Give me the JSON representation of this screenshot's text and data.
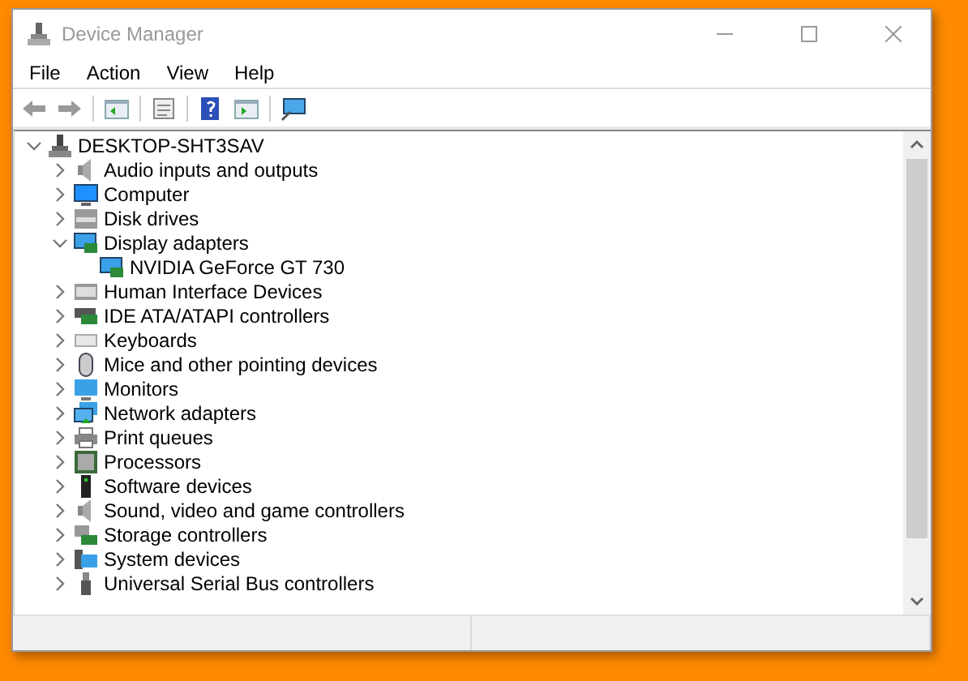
{
  "window": {
    "title": "Device Manager"
  },
  "menu": [
    "File",
    "Action",
    "View",
    "Help"
  ],
  "tree": {
    "label": "DESKTOP-SHT3SAV",
    "expanded": true,
    "children": [
      {
        "label": "Audio inputs and outputs",
        "expanded": false
      },
      {
        "label": "Computer",
        "expanded": false
      },
      {
        "label": "Disk drives",
        "expanded": false
      },
      {
        "label": "Display adapters",
        "expanded": true,
        "children": [
          {
            "label": "NVIDIA GeForce GT 730"
          }
        ]
      },
      {
        "label": "Human Interface Devices",
        "expanded": false
      },
      {
        "label": "IDE ATA/ATAPI controllers",
        "expanded": false
      },
      {
        "label": "Keyboards",
        "expanded": false
      },
      {
        "label": "Mice and other pointing devices",
        "expanded": false
      },
      {
        "label": "Monitors",
        "expanded": false
      },
      {
        "label": "Network adapters",
        "expanded": false
      },
      {
        "label": "Print queues",
        "expanded": false
      },
      {
        "label": "Processors",
        "expanded": false
      },
      {
        "label": "Software devices",
        "expanded": false
      },
      {
        "label": "Sound, video and game controllers",
        "expanded": false
      },
      {
        "label": "Storage controllers",
        "expanded": false
      },
      {
        "label": "System devices",
        "expanded": false
      },
      {
        "label": "Universal Serial Bus controllers",
        "expanded": false
      }
    ]
  }
}
